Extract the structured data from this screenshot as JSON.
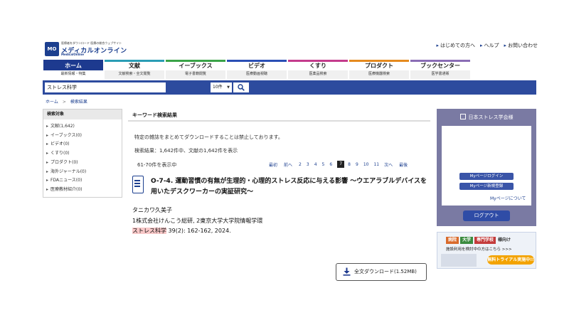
{
  "header": {
    "logo_tagline": "医療者をダウンロード 医療の総合ウェブサイト",
    "logo_text": "メディカルオンライン",
    "logo_sub": "MedicalOnline",
    "logo_mark": "MO",
    "top_links": [
      "はじめての方へ",
      "ヘルプ",
      "お問い合わせ"
    ]
  },
  "nav": {
    "tabs": [
      {
        "label": "ホーム",
        "sub": "最新情報・特集",
        "color": "#1d3a8f"
      },
      {
        "label": "文献",
        "sub": "文献検索・全文閲覧",
        "color": "#2a9db5"
      },
      {
        "label": "イーブックス",
        "sub": "電子書籍閲覧",
        "color": "#3aa348"
      },
      {
        "label": "ビデオ",
        "sub": "医療動画視聴",
        "color": "#2a4fb5"
      },
      {
        "label": "くすり",
        "sub": "医薬品検索",
        "color": "#c43c8c"
      },
      {
        "label": "プロダクト",
        "sub": "医療機器検索",
        "color": "#e58a1f"
      },
      {
        "label": "ブックセンター",
        "sub": "医学書通販",
        "color": "#8a6db5"
      }
    ]
  },
  "search": {
    "query": "ストレス科学",
    "per_page": "10件"
  },
  "breadcrumb": {
    "home": "ホーム",
    "sep": ">",
    "current": "検索結果"
  },
  "left_panel": {
    "title": "検索対象",
    "items": [
      "文献(1,642)",
      "イーブックス(0)",
      "ビデオ(0)",
      "くすり(0)",
      "プロダクト(0)",
      "海外ジャーナル(0)",
      "FDAニュース(0)",
      "医療教材紹介(0)"
    ]
  },
  "main": {
    "title": "キーワード検索結果",
    "notice": "特定の雑誌をまとめてダウンロードすることは禁止しております。",
    "result_count": "検索結果：1,642件中、文献の1,642件を表示",
    "showing": "61-70件を表示中",
    "pagination": {
      "first": "最初",
      "prev": "前へ",
      "pages": [
        "2",
        "3",
        "4",
        "5",
        "6",
        "7",
        "8",
        "9",
        "10",
        "11"
      ],
      "current": "7",
      "next": "次へ",
      "last": "最後"
    },
    "article": {
      "title": "O-7-4. 運動習慣の有無が生理的・心理的ストレス反応に与える影響 ～ウエアラブルデバイスを用いたデスクワーカーの実証研究～",
      "authors": "タニカワ久美子",
      "affiliation": "1株式会社けんこう総研, 2東京大学大学院情報学環",
      "journal": "ストレス科学",
      "citation_rest": " 39(2): 162-162, 2024.",
      "download_label": "全文ダウンロード(1.52MB)"
    }
  },
  "right_panel": {
    "org_name": "日本ストレス学会様",
    "mypage_login": "Myページログイン",
    "mypage_register": "Myページ新規登録",
    "mypage_about": "Myページについて",
    "logout": "ログアウト"
  },
  "banner": {
    "badges": [
      "病院",
      "大学",
      "専門学校"
    ],
    "badge_suffix": "様向け",
    "text": "施設利用を検討中の方はこちら >>>",
    "trial": "無料トライアル実施中!!"
  }
}
